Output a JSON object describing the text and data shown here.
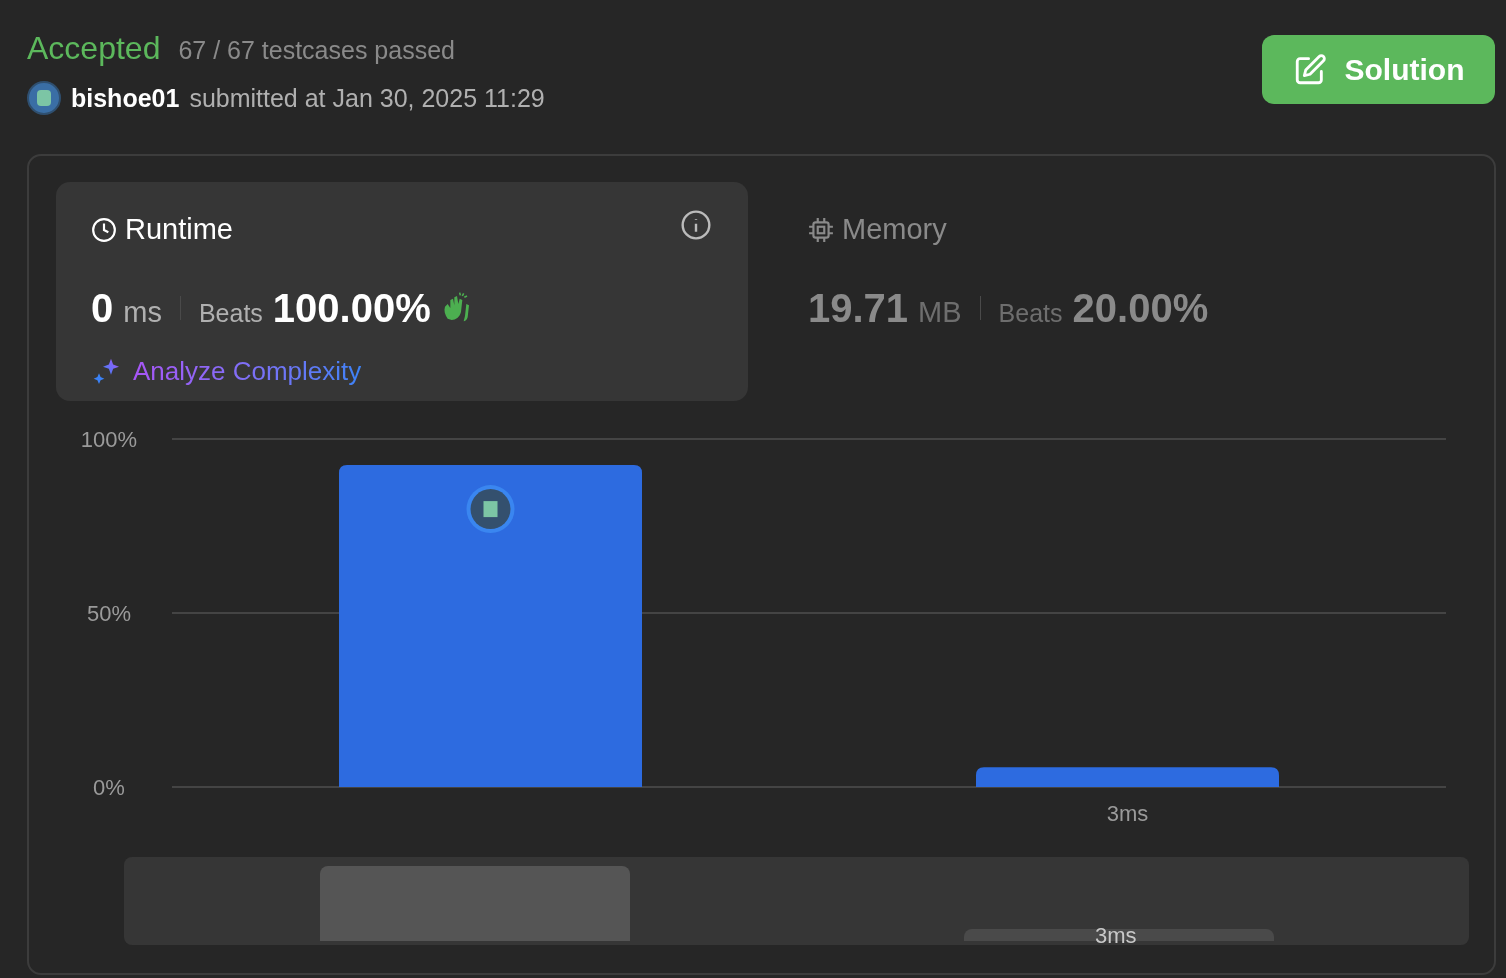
{
  "header": {
    "status": "Accepted",
    "testcases": "67 / 67 testcases passed",
    "username": "bishoe01",
    "submitted": "submitted at Jan 30, 2025 11:29",
    "solution_button": "Solution"
  },
  "metrics": [
    {
      "kind": "runtime",
      "title": "Runtime",
      "value": "0",
      "unit": "ms",
      "beats_label": "Beats",
      "beats": "100.00%",
      "selected": true,
      "link": "Analyze Complexity"
    },
    {
      "kind": "memory",
      "title": "Memory",
      "value": "19.71",
      "unit": "MB",
      "beats_label": "Beats",
      "beats": "20.00%",
      "selected": false
    }
  ],
  "chart_data": {
    "type": "bar",
    "categories": [
      null,
      "3ms"
    ],
    "series": [
      {
        "color": "#2d6be0",
        "values": [
          92.5,
          5.7
        ]
      }
    ],
    "ylim": [
      0,
      100
    ],
    "yticks": [
      {
        "value": 0,
        "label": "0%"
      },
      {
        "value": 50,
        "label": "50%"
      },
      {
        "value": 100,
        "label": "100%"
      }
    ]
  },
  "overview": {
    "label": "3ms"
  }
}
